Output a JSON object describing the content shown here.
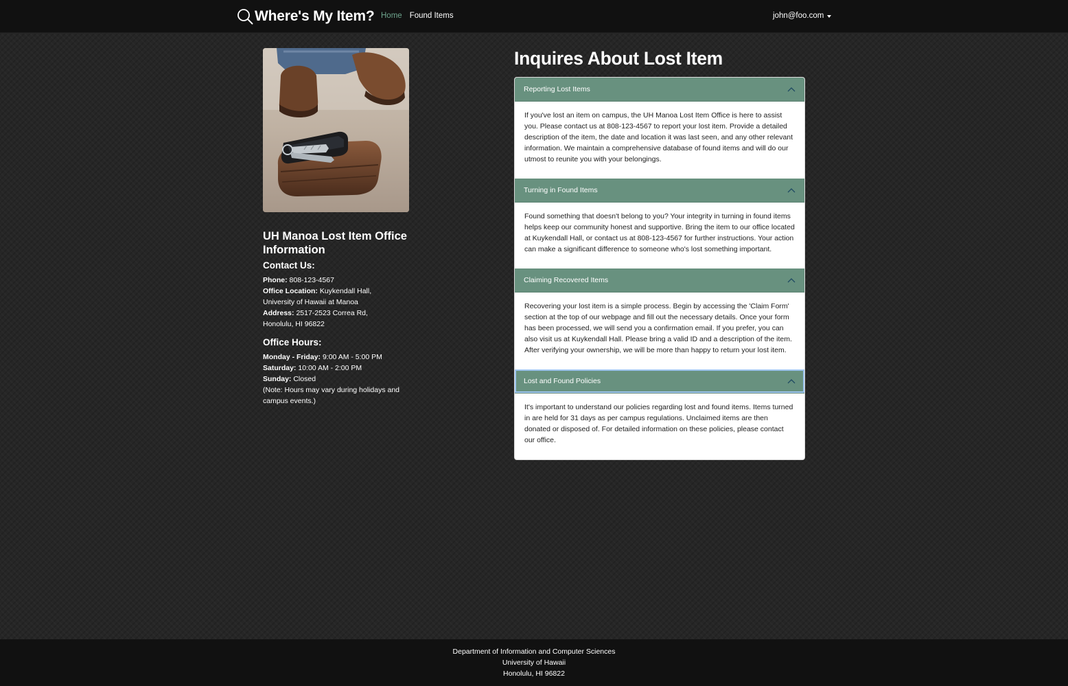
{
  "navbar": {
    "brand": "Where's My Item?",
    "brand_icon": "search-icon",
    "links": [
      {
        "label": "Home",
        "active": true
      },
      {
        "label": "Found Items",
        "active": false
      }
    ],
    "user": "john@foo.com"
  },
  "sidebar": {
    "image_alt": "wallet-keys-phone-photo",
    "office_title": "UH Manoa Lost Item Office Information",
    "contact_heading": "Contact Us:",
    "contact": {
      "phone_label": "Phone:",
      "phone": "808-123-4567",
      "location_label": "Office Location:",
      "location": "Kuykendall Hall, University of Hawaii at Manoa",
      "address_label": "Address:",
      "address": "2517-2523 Correa Rd, Honolulu, HI 96822"
    },
    "hours_heading": "Office Hours:",
    "hours": {
      "weekday_label": "Monday - Friday:",
      "weekday": "9:00 AM - 5:00 PM",
      "saturday_label": "Saturday:",
      "saturday": "10:00 AM - 2:00 PM",
      "sunday_label": "Sunday:",
      "sunday": "Closed",
      "note": "(Note: Hours may vary during holidays and campus events.)"
    }
  },
  "main": {
    "title": "Inquires About Lost Item",
    "sections": [
      {
        "title": "Reporting Lost Items",
        "body": "If you've lost an item on campus, the UH Manoa Lost Item Office is here to assist you. Please contact us at 808-123-4567 to report your lost item. Provide a detailed description of the item, the date and location it was last seen, and any other relevant information. We maintain a comprehensive database of found items and will do our utmost to reunite you with your belongings."
      },
      {
        "title": "Turning in Found Items",
        "body": "Found something that doesn't belong to you? Your integrity in turning in found items helps keep our community honest and supportive. Bring the item to our office located at Kuykendall Hall, or contact us at 808-123-4567 for further instructions. Your action can make a significant difference to someone who's lost something important."
      },
      {
        "title": "Claiming Recovered Items",
        "body": "Recovering your lost item is a simple process. Begin by accessing the 'Claim Form' section at the top of our webpage and fill out the necessary details. Once your form has been processed, we will send you a confirmation email. If you prefer, you can also visit us at Kuykendall Hall. Please bring a valid ID and a description of the item. After verifying your ownership, we will be more than happy to return your lost item."
      },
      {
        "title": "Lost and Found Policies",
        "body": "It's important to understand our policies regarding lost and found items. Items turned in are held for 31 days as per campus regulations. Unclaimed items are then donated or disposed of. For detailed information on these policies, please contact our office."
      }
    ]
  },
  "footer": {
    "line1": "Department of Information and Computer Sciences",
    "line2": "University of Hawaii",
    "line3": "Honolulu, HI 96822"
  },
  "colors": {
    "accent": "#68917f",
    "active_link": "#6da38c",
    "navbar_bg": "#111111",
    "page_bg": "#262626"
  }
}
